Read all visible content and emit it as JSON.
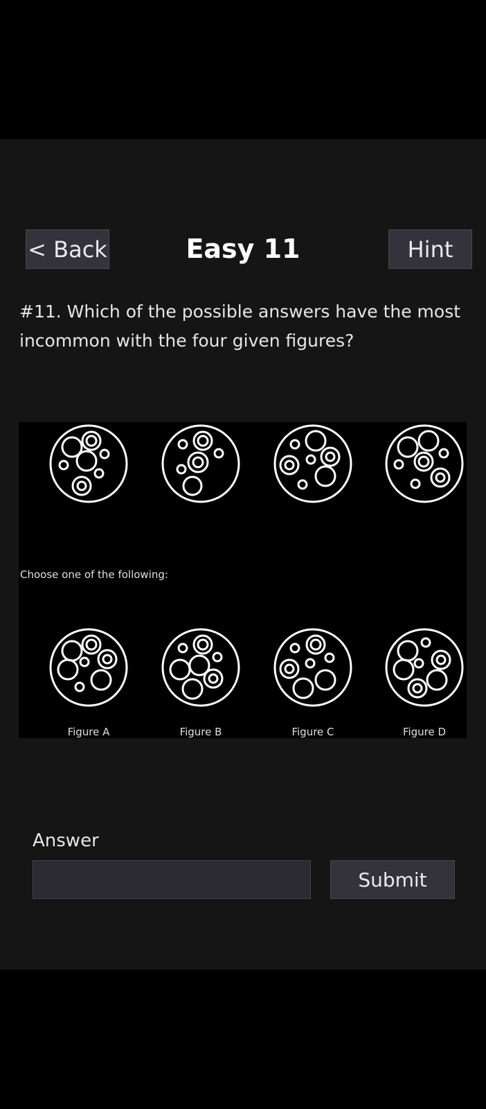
{
  "header": {
    "back_label": "< Back",
    "title": "Easy 11",
    "hint_label": "Hint"
  },
  "question": {
    "text": "#11. Which of the possible answers have the most incommon with the four given figures?"
  },
  "puzzle": {
    "choose_text": "Choose one of the following:",
    "figures": [
      {
        "label": "Figure A"
      },
      {
        "label": "Figure B"
      },
      {
        "label": "Figure C"
      },
      {
        "label": "Figure D"
      }
    ]
  },
  "answer": {
    "label": "Answer",
    "value": "",
    "placeholder": ""
  },
  "submit": {
    "label": "Submit"
  },
  "colors": {
    "app_background": "#151515",
    "button_background": "#34333b",
    "puzzle_background": "#000000",
    "figure_stroke": "#ffffff"
  }
}
